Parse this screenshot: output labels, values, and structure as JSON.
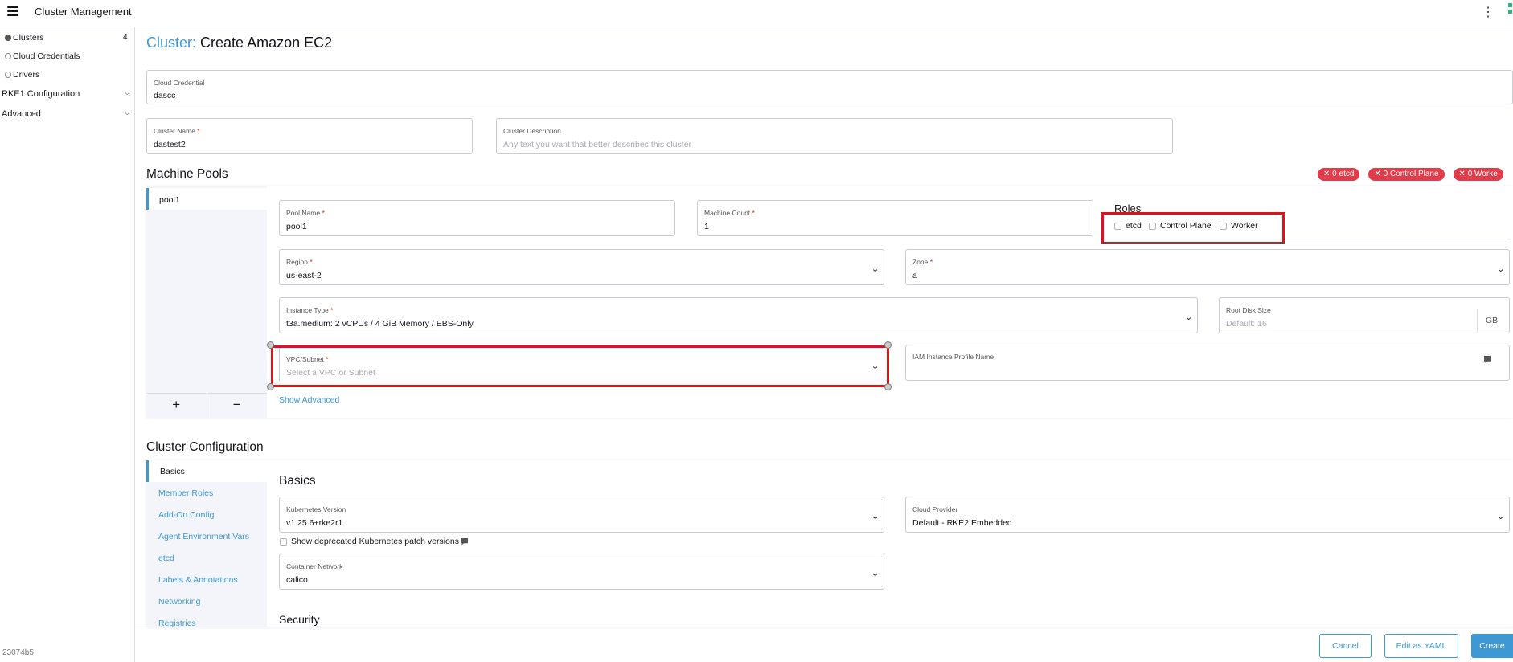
{
  "topbar": {
    "title": "Cluster Management"
  },
  "sidebar": {
    "items": [
      {
        "label": "Clusters",
        "count": "4"
      },
      {
        "label": "Cloud Credentials"
      },
      {
        "label": "Drivers"
      }
    ],
    "groups": [
      {
        "label": "RKE1 Configuration"
      },
      {
        "label": "Advanced"
      }
    ],
    "version": "23074b5"
  },
  "page": {
    "title_prefix": "Cluster:",
    "title_main": "Create Amazon EC2"
  },
  "cloud_credential": {
    "label": "Cloud Credential",
    "value": "dascc"
  },
  "cluster_name": {
    "label": "Cluster Name",
    "value": "dastest2"
  },
  "cluster_description": {
    "label": "Cluster Description",
    "placeholder": "Any text you want that better describes this cluster"
  },
  "machine_pools": {
    "title": "Machine Pools",
    "badges": [
      "0 etcd",
      "0 Control Plane",
      "0 Worke"
    ],
    "pool_tab": "pool1",
    "add": "+",
    "remove": "−",
    "pool_name": {
      "label": "Pool Name",
      "value": "pool1"
    },
    "machine_count": {
      "label": "Machine Count",
      "value": "1"
    },
    "roles": {
      "title": "Roles",
      "etcd": "etcd",
      "control_plane": "Control Plane",
      "worker": "Worker"
    },
    "region": {
      "label": "Region",
      "value": "us-east-2"
    },
    "zone": {
      "label": "Zone",
      "value": "a"
    },
    "instance_type": {
      "label": "Instance Type",
      "value": "t3a.medium: 2 vCPUs / 4 GiB Memory / EBS-Only"
    },
    "root_disk": {
      "label": "Root Disk Size",
      "placeholder": "Default: 16",
      "unit": "GB"
    },
    "vpc": {
      "label": "VPC/Subnet",
      "placeholder": "Select a VPC or Subnet"
    },
    "iam": {
      "label": "IAM Instance Profile Name"
    },
    "show_advanced": "Show Advanced"
  },
  "cluster_config": {
    "title": "Cluster Configuration",
    "tabs": [
      "Basics",
      "Member Roles",
      "Add-On Config",
      "Agent Environment Vars",
      "etcd",
      "Labels & Annotations",
      "Networking",
      "Registries"
    ],
    "basics_title": "Basics",
    "k8s_version": {
      "label": "Kubernetes Version",
      "value": "v1.25.6+rke2r1"
    },
    "cloud_provider": {
      "label": "Cloud Provider",
      "value": "Default - RKE2 Embedded"
    },
    "show_deprecated": "Show deprecated Kubernetes patch versions",
    "container_network": {
      "label": "Container Network",
      "value": "calico"
    },
    "security_title": "Security"
  },
  "footer": {
    "cancel": "Cancel",
    "edit_yaml": "Edit as YAML",
    "create": "Create"
  },
  "colors": {
    "accent": "#3d98d3",
    "badge": "#e23b4a",
    "highlight": "#e3101e"
  }
}
